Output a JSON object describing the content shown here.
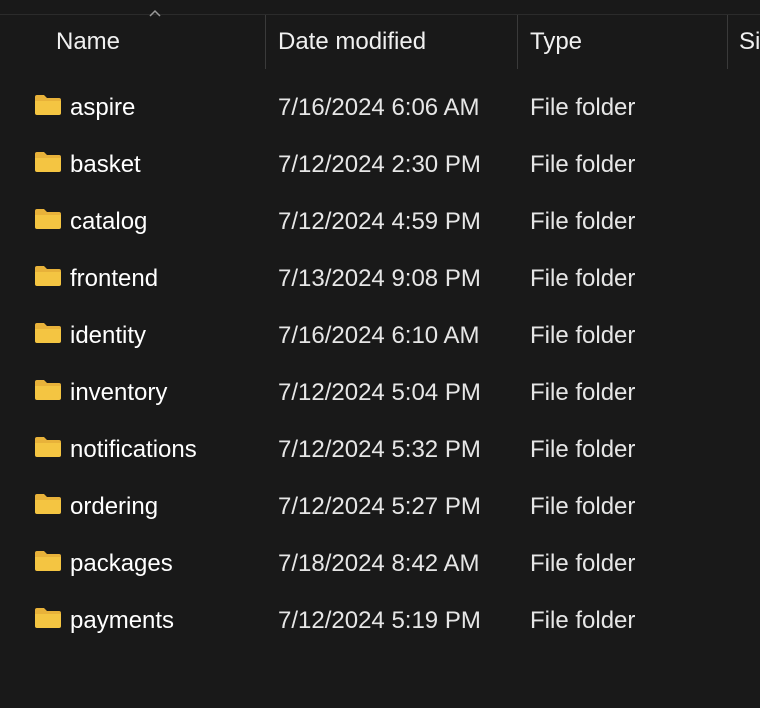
{
  "columns": {
    "name": "Name",
    "date_modified": "Date modified",
    "type": "Type",
    "size": "Si"
  },
  "sort_indicator_icon": "chevron-up-icon",
  "folder_icon": "folder-icon",
  "colors": {
    "background": "#191919",
    "folder_fill": "#f4c542",
    "folder_tab": "#e8b23a",
    "text": "#ffffff"
  },
  "rows": [
    {
      "name": "aspire",
      "date": "7/16/2024 6:06 AM",
      "type": "File folder"
    },
    {
      "name": "basket",
      "date": "7/12/2024 2:30 PM",
      "type": "File folder"
    },
    {
      "name": "catalog",
      "date": "7/12/2024 4:59 PM",
      "type": "File folder"
    },
    {
      "name": "frontend",
      "date": "7/13/2024 9:08 PM",
      "type": "File folder"
    },
    {
      "name": "identity",
      "date": "7/16/2024 6:10 AM",
      "type": "File folder"
    },
    {
      "name": "inventory",
      "date": "7/12/2024 5:04 PM",
      "type": "File folder"
    },
    {
      "name": "notifications",
      "date": "7/12/2024 5:32 PM",
      "type": "File folder"
    },
    {
      "name": "ordering",
      "date": "7/12/2024 5:27 PM",
      "type": "File folder"
    },
    {
      "name": "packages",
      "date": "7/18/2024 8:42 AM",
      "type": "File folder"
    },
    {
      "name": "payments",
      "date": "7/12/2024 5:19 PM",
      "type": "File folder"
    }
  ]
}
